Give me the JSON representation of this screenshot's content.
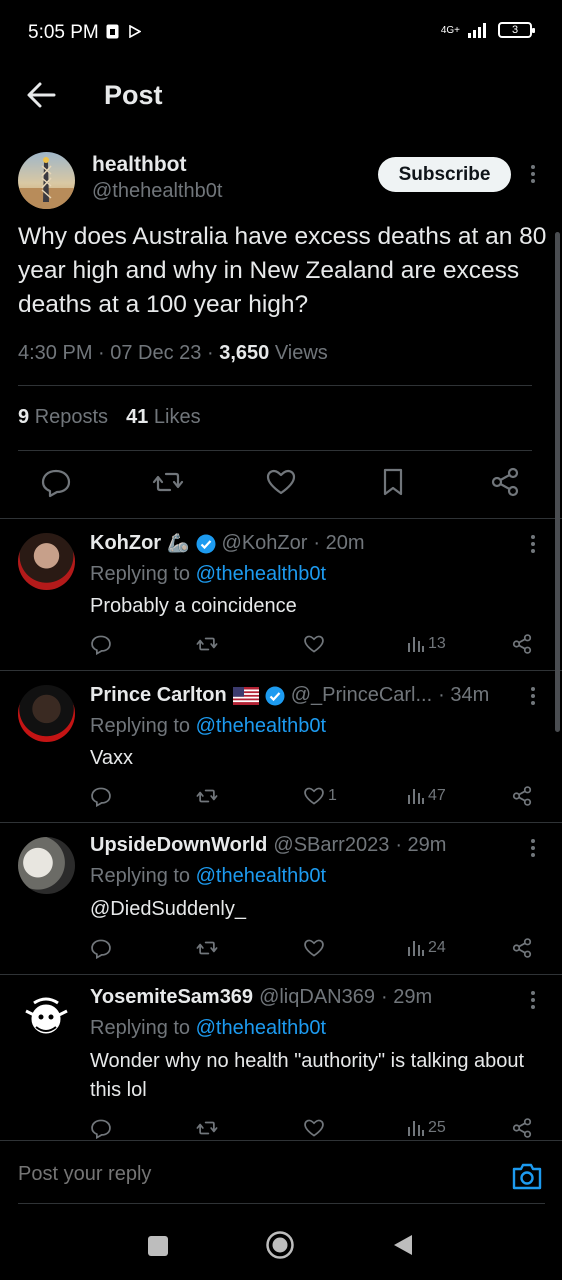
{
  "status_bar": {
    "time": "5:05 PM",
    "network": "4G+",
    "battery": "3"
  },
  "header": {
    "title": "Post"
  },
  "post": {
    "author_name": "healthbot",
    "author_handle": "@thehealthb0t",
    "subscribe_label": "Subscribe",
    "text": "Why does Australia have excess deaths at an 80 year high and why in New Zealand are excess deaths at a 100 year high?",
    "time": "4:30 PM · 07 Dec 23 · ",
    "views_count": "3,650",
    "views_label": " Views",
    "reposts_count": "9",
    "reposts_label": "Reposts",
    "likes_count": "41",
    "likes_label": "Likes"
  },
  "replies": [
    {
      "name": "KohZor",
      "emoji": "🦾",
      "verified": true,
      "handle": "@KohZor",
      "time": "· 20m",
      "replying_prefix": "Replying to ",
      "replying_to": "@thehealthb0t",
      "text": "Probably a coincidence",
      "text_is_link": false,
      "likes": "",
      "views": "13"
    },
    {
      "name": "Prince Carlton",
      "emoji": "🇺🇸",
      "verified": true,
      "handle": "@_PrinceCarl...",
      "time": "· 34m",
      "replying_prefix": "Replying to ",
      "replying_to": "@thehealthb0t",
      "text": "Vaxx",
      "text_is_link": false,
      "likes": "1",
      "views": "47"
    },
    {
      "name": "UpsideDownWorld",
      "emoji": "",
      "verified": false,
      "handle": "@SBarr2023",
      "time": "· 29m",
      "replying_prefix": "Replying to ",
      "replying_to": "@thehealthb0t",
      "text": "@DiedSuddenly_",
      "text_is_link": true,
      "likes": "",
      "views": "24"
    },
    {
      "name": "YosemiteSam369",
      "emoji": "",
      "verified": false,
      "handle": "@liqDAN369",
      "time": "· 29m",
      "replying_prefix": "Replying to ",
      "replying_to": "@thehealthb0t",
      "text": "Wonder why no health \"authority\" is talking about this lol",
      "text_is_link": false,
      "likes": "",
      "views": "25"
    }
  ],
  "composer": {
    "placeholder": "Post your reply"
  },
  "colors": {
    "background": "#000000",
    "accent": "#1d9bf0",
    "muted": "#71767b",
    "text": "#e7e9ea"
  }
}
